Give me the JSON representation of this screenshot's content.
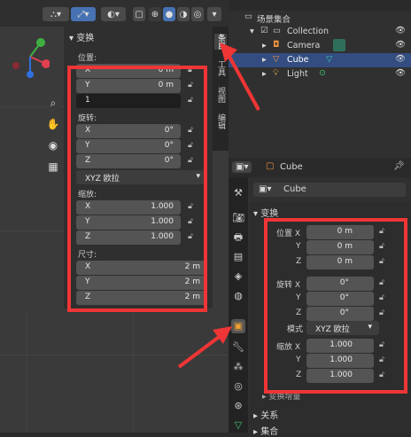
{
  "viewport": {
    "header_icons": [
      "select-icon",
      "cursor-icon",
      "view-icon",
      "wireframe-icon",
      "solid-icon",
      "material-icon",
      "rendered-icon"
    ]
  },
  "npanel": {
    "title": "变换",
    "location_label": "位置:",
    "location": [
      {
        "axis": "X",
        "value": "0 m"
      },
      {
        "axis": "Y",
        "value": "0 m"
      },
      {
        "axis": "",
        "value": "1"
      }
    ],
    "rotation_label": "旋转:",
    "rotation": [
      {
        "axis": "X",
        "value": "0°"
      },
      {
        "axis": "Y",
        "value": "0°"
      },
      {
        "axis": "Z",
        "value": "0°"
      }
    ],
    "rotation_mode": "XYZ 欧拉",
    "scale_label": "缩放:",
    "scale": [
      {
        "axis": "X",
        "value": "1.000"
      },
      {
        "axis": "Y",
        "value": "1.000"
      },
      {
        "axis": "Z",
        "value": "1.000"
      }
    ],
    "dimensions_label": "尺寸:",
    "dimensions": [
      {
        "axis": "X",
        "value": "2 m"
      },
      {
        "axis": "Y",
        "value": "2 m"
      },
      {
        "axis": "Z",
        "value": "2 m"
      }
    ]
  },
  "ntabs": [
    "条目",
    "工具",
    "视图",
    "编辑"
  ],
  "outliner": {
    "scene_collection": "场景集合",
    "collection": "Collection",
    "items": [
      "Camera",
      "Cube",
      "Light"
    ]
  },
  "properties": {
    "object_name": "Cube",
    "object_name_field": "Cube",
    "section_title": "变换",
    "location_label": "位置 X",
    "location": [
      {
        "axis": "X",
        "value": "0 m"
      },
      {
        "axis": "Y",
        "value": "0 m"
      },
      {
        "axis": "Z",
        "value": "0 m"
      }
    ],
    "rotation_label": "旋转 X",
    "rotation": [
      {
        "axis": "X",
        "value": "0°"
      },
      {
        "axis": "Y",
        "value": "0°"
      },
      {
        "axis": "Z",
        "value": "0°"
      }
    ],
    "mode_label": "模式",
    "mode_value": "XYZ 欧拉",
    "scale_label": "缩放 X",
    "scale": [
      {
        "axis": "X",
        "value": "1.000"
      },
      {
        "axis": "Y",
        "value": "1.000"
      },
      {
        "axis": "Z",
        "value": "1.000"
      }
    ],
    "delta_transform": "变换增量",
    "relations": "关系",
    "collections": "集合"
  },
  "colors": {
    "accent": "#4772b3",
    "highlight": "#ef3535",
    "selected_row": "#334d80"
  }
}
